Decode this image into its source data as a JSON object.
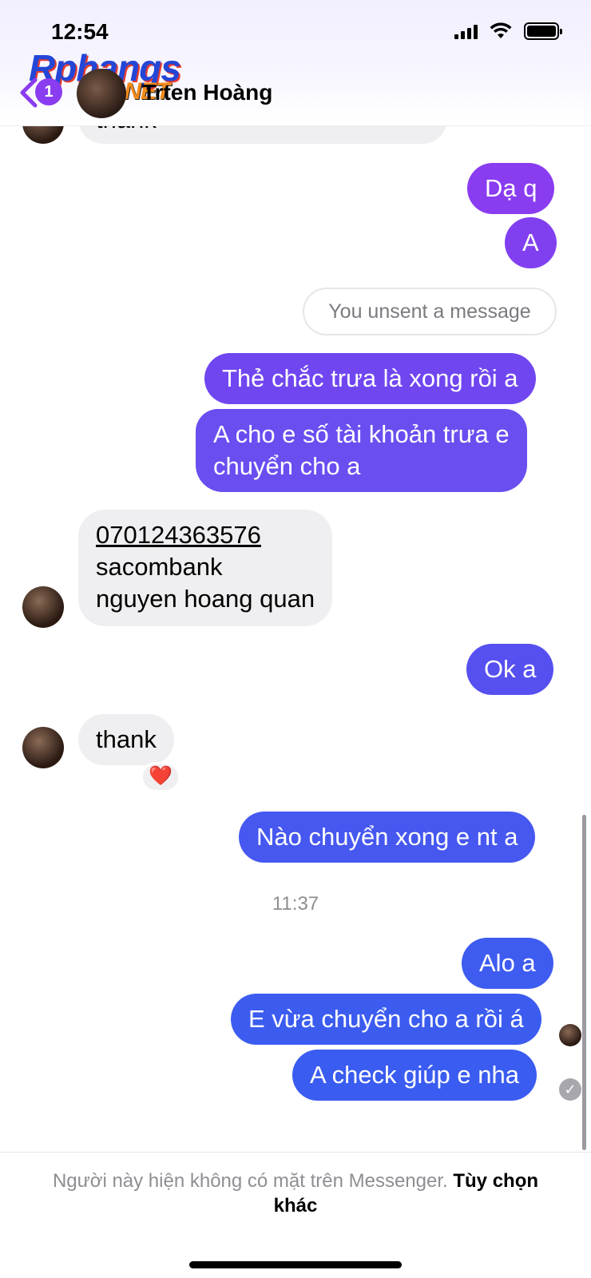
{
  "status_bar": {
    "time": "12:54"
  },
  "watermark": {
    "text": "Rphangs",
    "suffix": ".NET"
  },
  "header": {
    "back_badge": "1",
    "contact_name": "Tiến Hoàng",
    "contact_name_visible": "Trten Hoàng"
  },
  "messages": {
    "top_partial": "thank",
    "m1": "Dạ q",
    "m2": "A",
    "unsent": "You unsent a message",
    "m3": "Thẻ chắc trưa là xong rồi a",
    "m4_line1": "A cho e số tài khoản trưa e",
    "m4_line2": "chuyển cho a",
    "in1_line1": "070124363576",
    "in1_line2": "sacombank",
    "in1_line3": "nguyen hoang quan",
    "m5": "Ok a",
    "in2": "thank",
    "in2_reaction": "❤️",
    "m6": "Nào chuyển xong e nt a",
    "timestamp": "11:37",
    "m7": "Alo a",
    "m8": "E vừa chuyển cho a rồi á",
    "m9": "A check giúp e nha",
    "sent_check": "✓"
  },
  "footer": {
    "notice": "Người này hiện không có mặt trên Messenger.",
    "link": "Tùy chọn khác"
  },
  "colors": {
    "purple_top": "#8a3cf0",
    "purple_mid": "#6a4ef0",
    "blue_bottom": "#3a5cf0",
    "incoming_bg": "#efeff1"
  }
}
